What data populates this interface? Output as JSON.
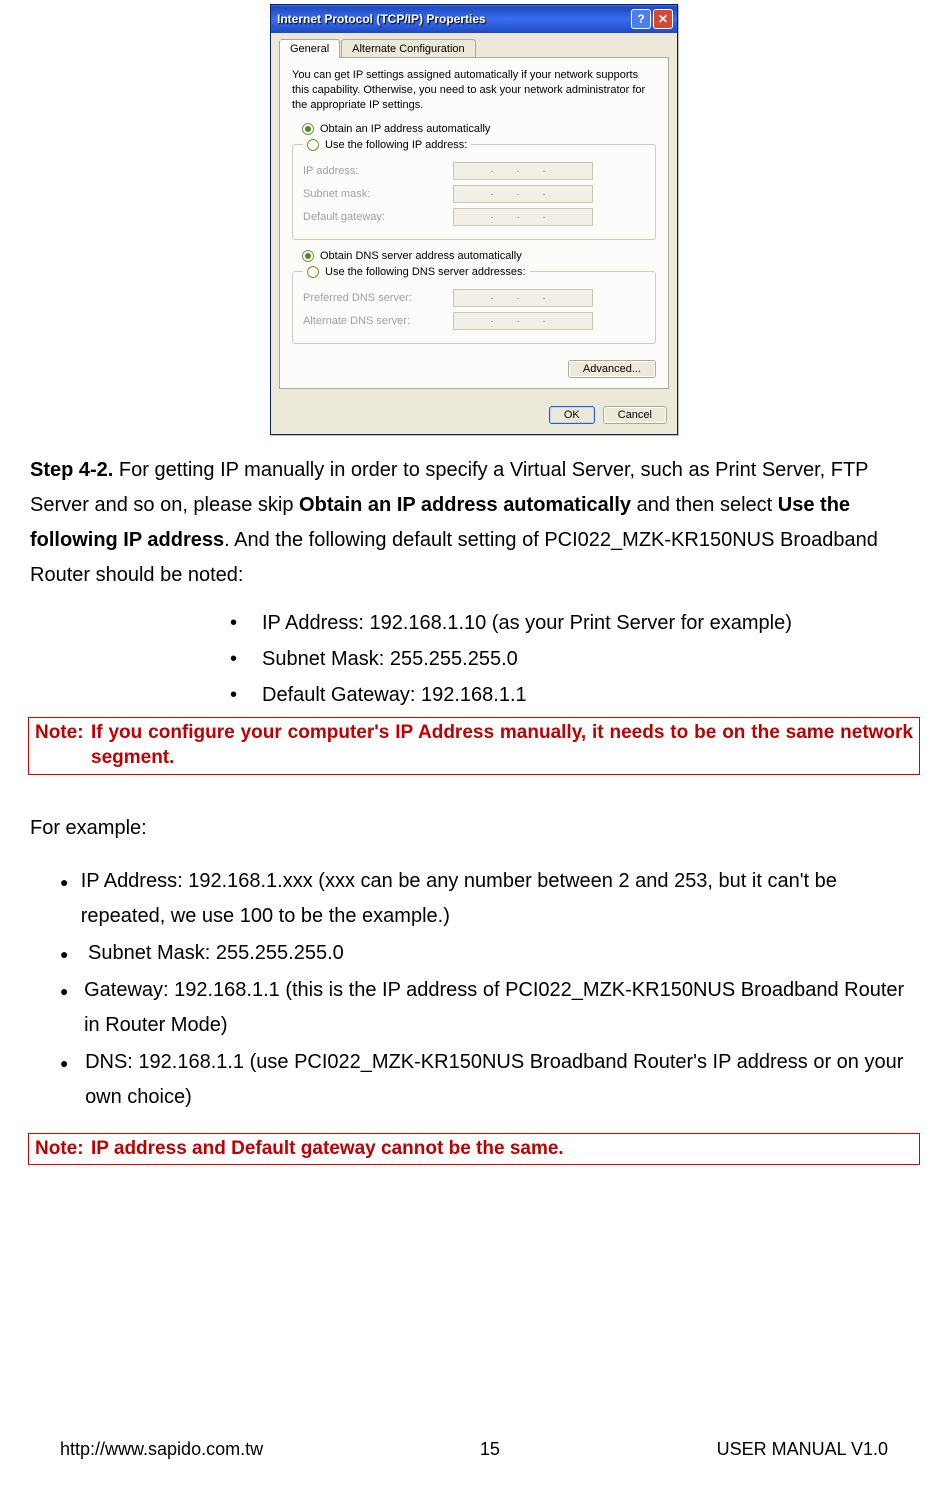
{
  "dialog": {
    "title": "Internet Protocol (TCP/IP) Properties",
    "tabs": {
      "general": "General",
      "alt": "Alternate Configuration"
    },
    "desc": "You can get IP settings assigned automatically if your network supports this capability. Otherwise, you need to ask your network administrator for the appropriate IP settings.",
    "radio": {
      "autoIp": "Obtain an IP address automatically",
      "useIp": "Use the following IP address:",
      "autoDns": "Obtain DNS server address automatically",
      "useDns": "Use the following DNS server addresses:"
    },
    "labels": {
      "ip": "IP address:",
      "subnet": "Subnet mask:",
      "gateway": "Default gateway:",
      "prefDns": "Preferred DNS server:",
      "altDns": "Alternate DNS server:"
    },
    "ipDots": ".   .   .",
    "buttons": {
      "advanced": "Advanced...",
      "ok": "OK",
      "cancel": "Cancel"
    }
  },
  "stepLabel": "Step 4-2.",
  "stepText1": " For getting IP manually in order to specify a Virtual Server, such as Print Server, FTP Server and so on, please skip ",
  "stepBold1": "Obtain an IP address automatically",
  "stepText2": " and then select ",
  "stepBold2": "Use the following IP address",
  "stepText3": ". And the following default setting of PCI022_MZK-KR150NUS Broadband Router should be noted:",
  "sub": {
    "a": "IP Address: 192.168.1.10 (as your Print Server for example)",
    "b": "Subnet Mask: 255.255.255.0",
    "c": "Default Gateway: 192.168.1.1"
  },
  "note1pre": "Note:",
  "note1": "If you configure your computer's IP Address manually, it needs to be on the same network segment.",
  "exampleLabel": "For example:",
  "ex": {
    "a": "IP Address: 192.168.1.xxx (xxx can be any number between 2 and 253, but it can't be repeated, we use 100 to be the example.)",
    "b": "Subnet Mask: 255.255.255.0",
    "c": "Gateway: 192.168.1.1 (this is the IP address of PCI022_MZK-KR150NUS Broadband Router in Router Mode)",
    "d": "DNS: 192.168.1.1 (use PCI022_MZK-KR150NUS Broadband Router's IP address or on your own choice)"
  },
  "note2pre": "Note:",
  "note2": "IP address and Default gateway cannot be the same.",
  "footer": {
    "url": "http://www.sapido.com.tw",
    "page": "15",
    "ver": "USER MANUAL V1.0"
  }
}
